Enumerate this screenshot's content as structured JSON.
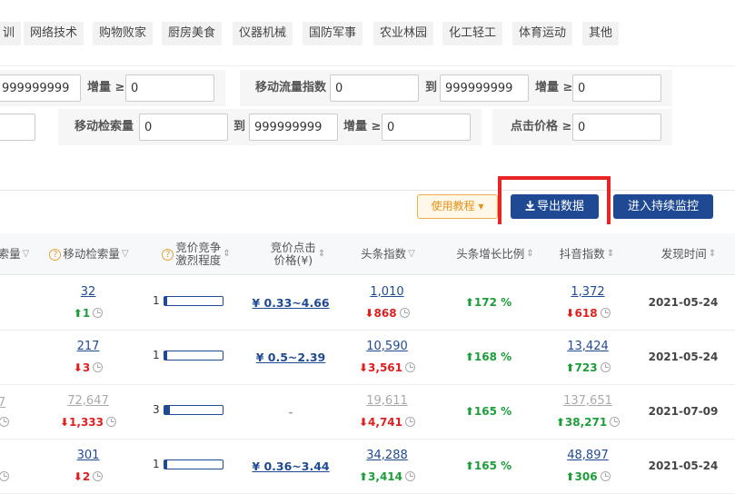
{
  "categories": [
    "训",
    "网络技术",
    "购物败家",
    "厨房美食",
    "仪器机械",
    "国防军事",
    "农业林园",
    "化工轻工",
    "体育运动",
    "其他"
  ],
  "filters": {
    "row1": {
      "left_value": "999999999",
      "increase_label": "增量 ≥",
      "increase_value": "0",
      "mobile_traffic_label": "移动流量指数",
      "mobile_traffic_from": "0",
      "to_label": "到",
      "mobile_traffic_to": "999999999",
      "increase2_label": "增量 ≥",
      "increase2_value": "0"
    },
    "row2": {
      "mobile_search_label": "移动检索量",
      "mobile_search_from": "0",
      "to_label": "到",
      "mobile_search_to": "999999999",
      "increase_label": "增量 ≥",
      "increase_value": "0",
      "click_price_label": "点击价格 ≥",
      "click_price_value": "0"
    }
  },
  "actions": {
    "tutorial_label": "使用教程",
    "tutorial_arrow": "▾",
    "export_label": "导出数据",
    "monitor_label": "进入持续监控"
  },
  "table": {
    "headers": {
      "search_volume": "索量",
      "mobile_search": "移动检索量",
      "competition_line1": "竞价竞争",
      "competition_line2": "激烈程度",
      "price_line1": "竞价点击",
      "price_line2": "价格(¥)",
      "toutiao_index": "头条指数",
      "toutiao_growth": "头条增长比例",
      "douyin_index": "抖音指数",
      "found_time": "发现时间"
    },
    "rows": [
      {
        "partial_value": "",
        "partial_delta": "",
        "mobile_search": "32",
        "mobile_search_delta": "1",
        "mobile_search_dir": "up",
        "competition_level": "1",
        "competition_fill": 0.04,
        "price": "¥ 0.33~4.66",
        "toutiao": "1,010",
        "toutiao_delta": "868",
        "toutiao_dir": "down",
        "toutiao_growth": "172 %",
        "douyin": "1,372",
        "douyin_delta": "618",
        "douyin_dir": "down",
        "date": "2021-05-24",
        "dim": false
      },
      {
        "partial_value": "",
        "partial_delta": "",
        "mobile_search": "217",
        "mobile_search_delta": "3",
        "mobile_search_dir": "down",
        "competition_level": "1",
        "competition_fill": 0.04,
        "price": "¥ 0.5~2.39",
        "toutiao": "10,590",
        "toutiao_delta": "3,561",
        "toutiao_dir": "down",
        "toutiao_growth": "168 %",
        "douyin": "13,424",
        "douyin_delta": "723",
        "douyin_dir": "up",
        "date": "2021-05-24",
        "dim": false
      },
      {
        "partial_value": "7",
        "partial_delta": "",
        "mobile_search": "72,647",
        "mobile_search_delta": "1,333",
        "mobile_search_dir": "down",
        "competition_level": "3",
        "competition_fill": 0.1,
        "price": "-",
        "toutiao": "19,611",
        "toutiao_delta": "4,741",
        "toutiao_dir": "down",
        "toutiao_growth": "165 %",
        "douyin": "137,651",
        "douyin_delta": "38,271",
        "douyin_dir": "up",
        "date": "2021-07-09",
        "dim": true
      },
      {
        "partial_value": "",
        "partial_delta": "",
        "mobile_search": "301",
        "mobile_search_delta": "2",
        "mobile_search_dir": "down",
        "competition_level": "1",
        "competition_fill": 0.04,
        "price": "¥ 0.36~3.44",
        "toutiao": "34,288",
        "toutiao_delta": "3,414",
        "toutiao_dir": "up",
        "toutiao_growth": "165 %",
        "douyin": "48,897",
        "douyin_delta": "306",
        "douyin_dir": "up",
        "date": "2021-05-24",
        "dim": false
      }
    ]
  },
  "colors": {
    "primary": "#1f4a93",
    "up": "#1e9e3a",
    "down": "#e02020",
    "highlight": "#e82424",
    "tutorial": "#e69016"
  }
}
